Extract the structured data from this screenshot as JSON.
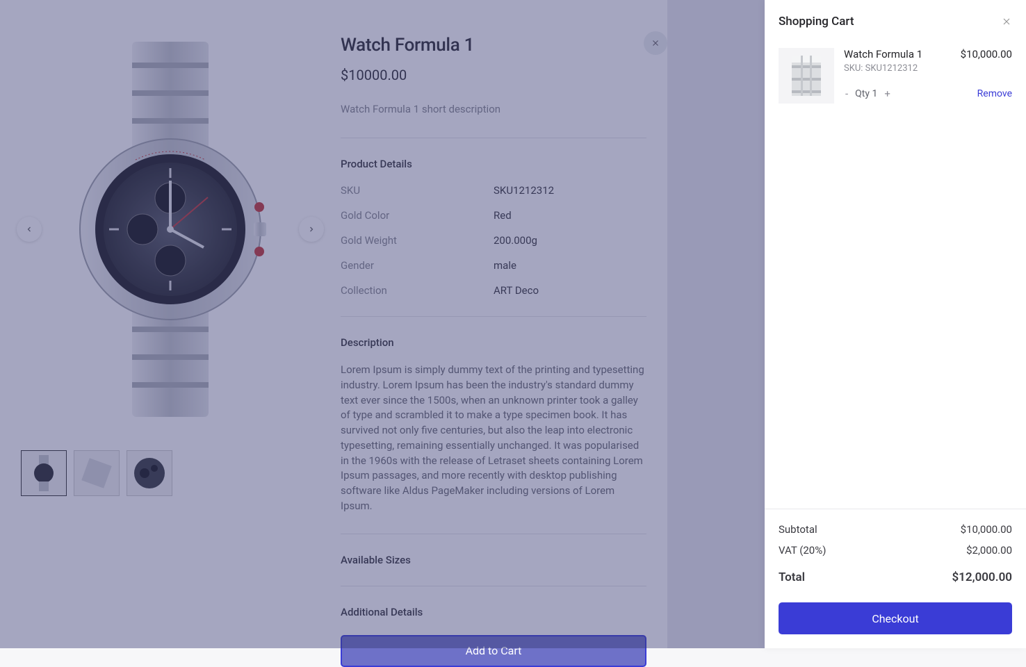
{
  "product": {
    "title": "Watch Formula 1",
    "price": "$10000.00",
    "short_desc": "Watch Formula 1 short description",
    "details_heading": "Product Details",
    "details": {
      "sku_label": "SKU",
      "sku_value": "SKU1212312",
      "goldcolor_label": "Gold Color",
      "goldcolor_value": "Red",
      "goldweight_label": "Gold Weight",
      "goldweight_value": "200.000g",
      "gender_label": "Gender",
      "gender_value": "male",
      "collection_label": "Collection",
      "collection_value": "ART Deco"
    },
    "description_heading": "Description",
    "description_text": "Lorem Ipsum is simply dummy text of the printing and typesetting industry. Lorem Ipsum has been the industry's standard dummy text ever since the 1500s, when an unknown printer took a galley of type and scrambled it to make a type specimen book. It has survived not only five centuries, but also the leap into electronic typesetting, remaining essentially unchanged. It was popularised in the 1960s with the release of Letraset sheets containing Lorem Ipsum passages, and more recently with desktop publishing software like Aldus PageMaker including versions of Lorem Ipsum.",
    "available_sizes_heading": "Available Sizes",
    "additional_details_heading": "Additional Details",
    "add_to_cart_label": "Add to Cart"
  },
  "cart": {
    "title": "Shopping Cart",
    "item": {
      "name": "Watch Formula 1",
      "price": "$10,000.00",
      "sku_line": "SKU: SKU1212312",
      "qty_label": "Qty 1",
      "remove_label": "Remove"
    },
    "summary": {
      "subtotal_label": "Subtotal",
      "subtotal_value": "$10,000.00",
      "vat_label": "VAT (20%)",
      "vat_value": "$2,000.00",
      "total_label": "Total",
      "total_value": "$12,000.00"
    },
    "checkout_label": "Checkout"
  }
}
